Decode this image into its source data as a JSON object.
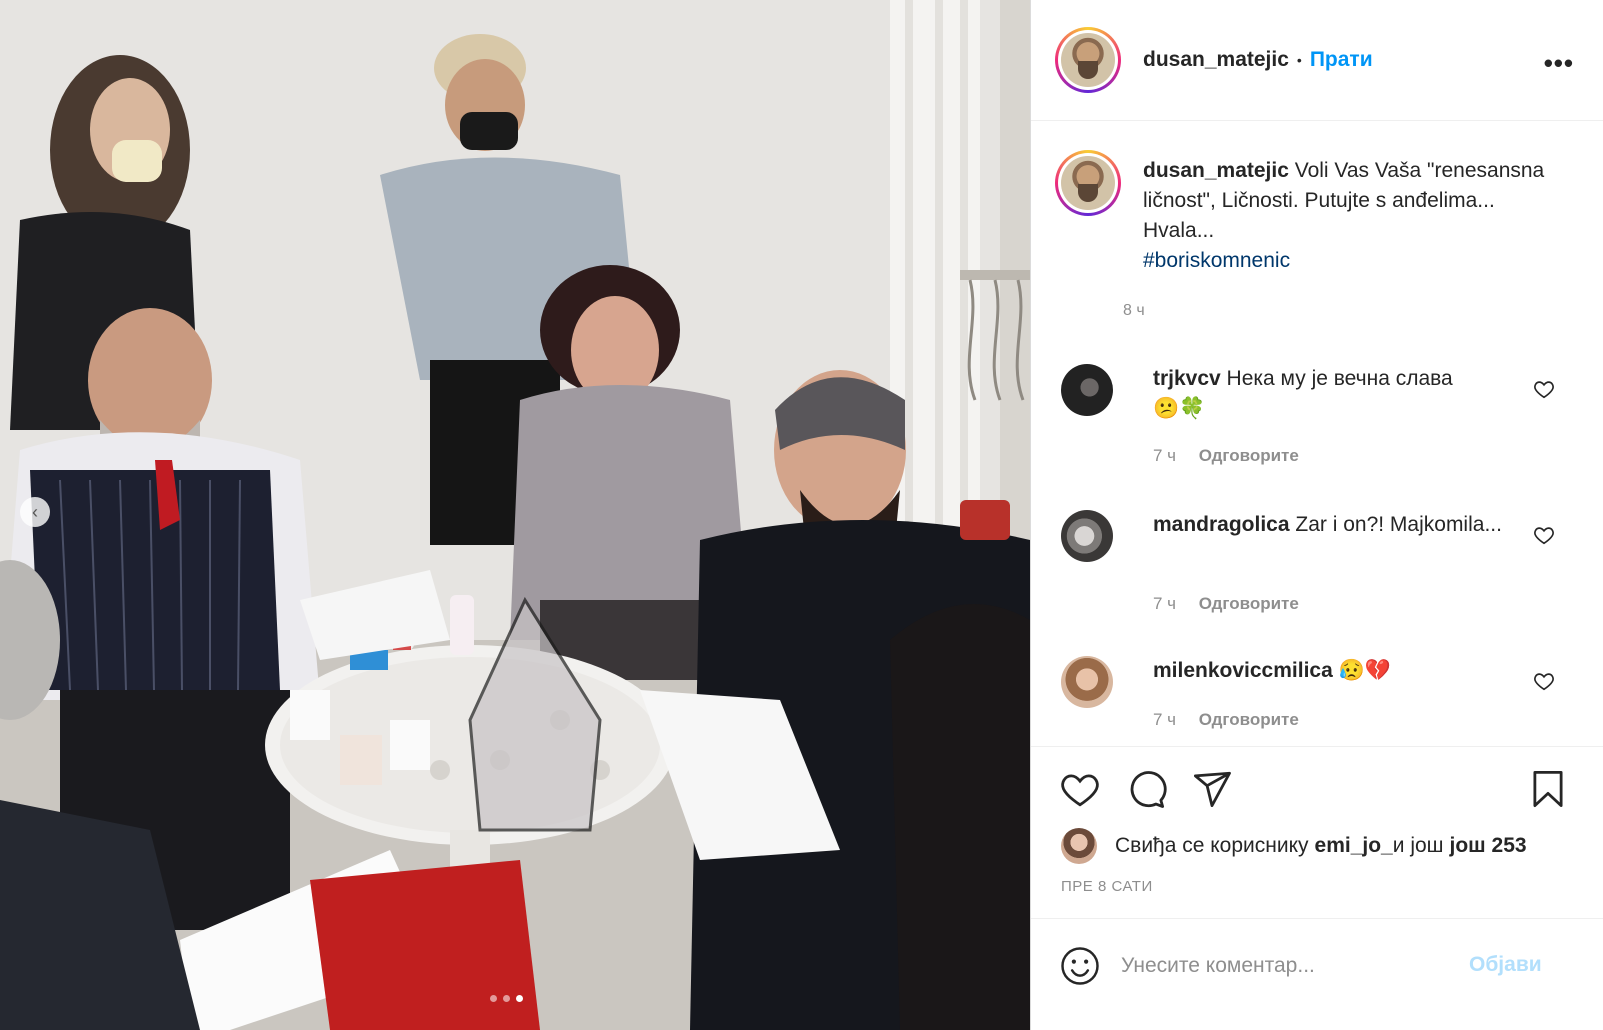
{
  "post": {
    "username": "dusan_matejic",
    "follow_label": "Прати",
    "separator": "•",
    "more_label": "•••"
  },
  "caption": {
    "username": "dusan_matejic",
    "text": " Voli Vas Vaša \"renesansna ličnost\", Ličnosti. Putujte s anđelima... Hvala...",
    "hashtag": "#boriskomnenic",
    "time": "8 ч"
  },
  "comments": [
    {
      "username": "trjkvcv",
      "text": " Нека му је вечна слава",
      "emoji": "😕🍀",
      "time": "7 ч",
      "reply_label": "Одговорите"
    },
    {
      "username": "mandragolica",
      "text": " Zar i on?! Majkomila...",
      "emoji": "",
      "time": "7 ч",
      "reply_label": "Одговорите"
    },
    {
      "username": "milenkoviccmilica",
      "text": " ",
      "emoji": "😥💔",
      "time": "7 ч",
      "reply_label": "Одговорите"
    }
  ],
  "likes": {
    "prefix": "Свиђа се кориснику ",
    "user": "emi_jo_",
    "middle": " и још ",
    "count": "још 253"
  },
  "post_date": "ПРЕ 8 САТИ",
  "comment_box": {
    "placeholder": "Унесите коментар...",
    "post_label": "Објави"
  },
  "carousel": {
    "prev_label": "‹",
    "total": 3,
    "active": 3
  },
  "colors": {
    "accent": "#0095f6",
    "post_disabled": "#b2dffc",
    "muted": "#8e8e8e",
    "border": "#dbdbdb"
  },
  "icons": [
    "chevron-left-icon",
    "more-icon",
    "heart-icon",
    "comment-icon",
    "share-icon",
    "bookmark-icon",
    "emoji-icon"
  ]
}
